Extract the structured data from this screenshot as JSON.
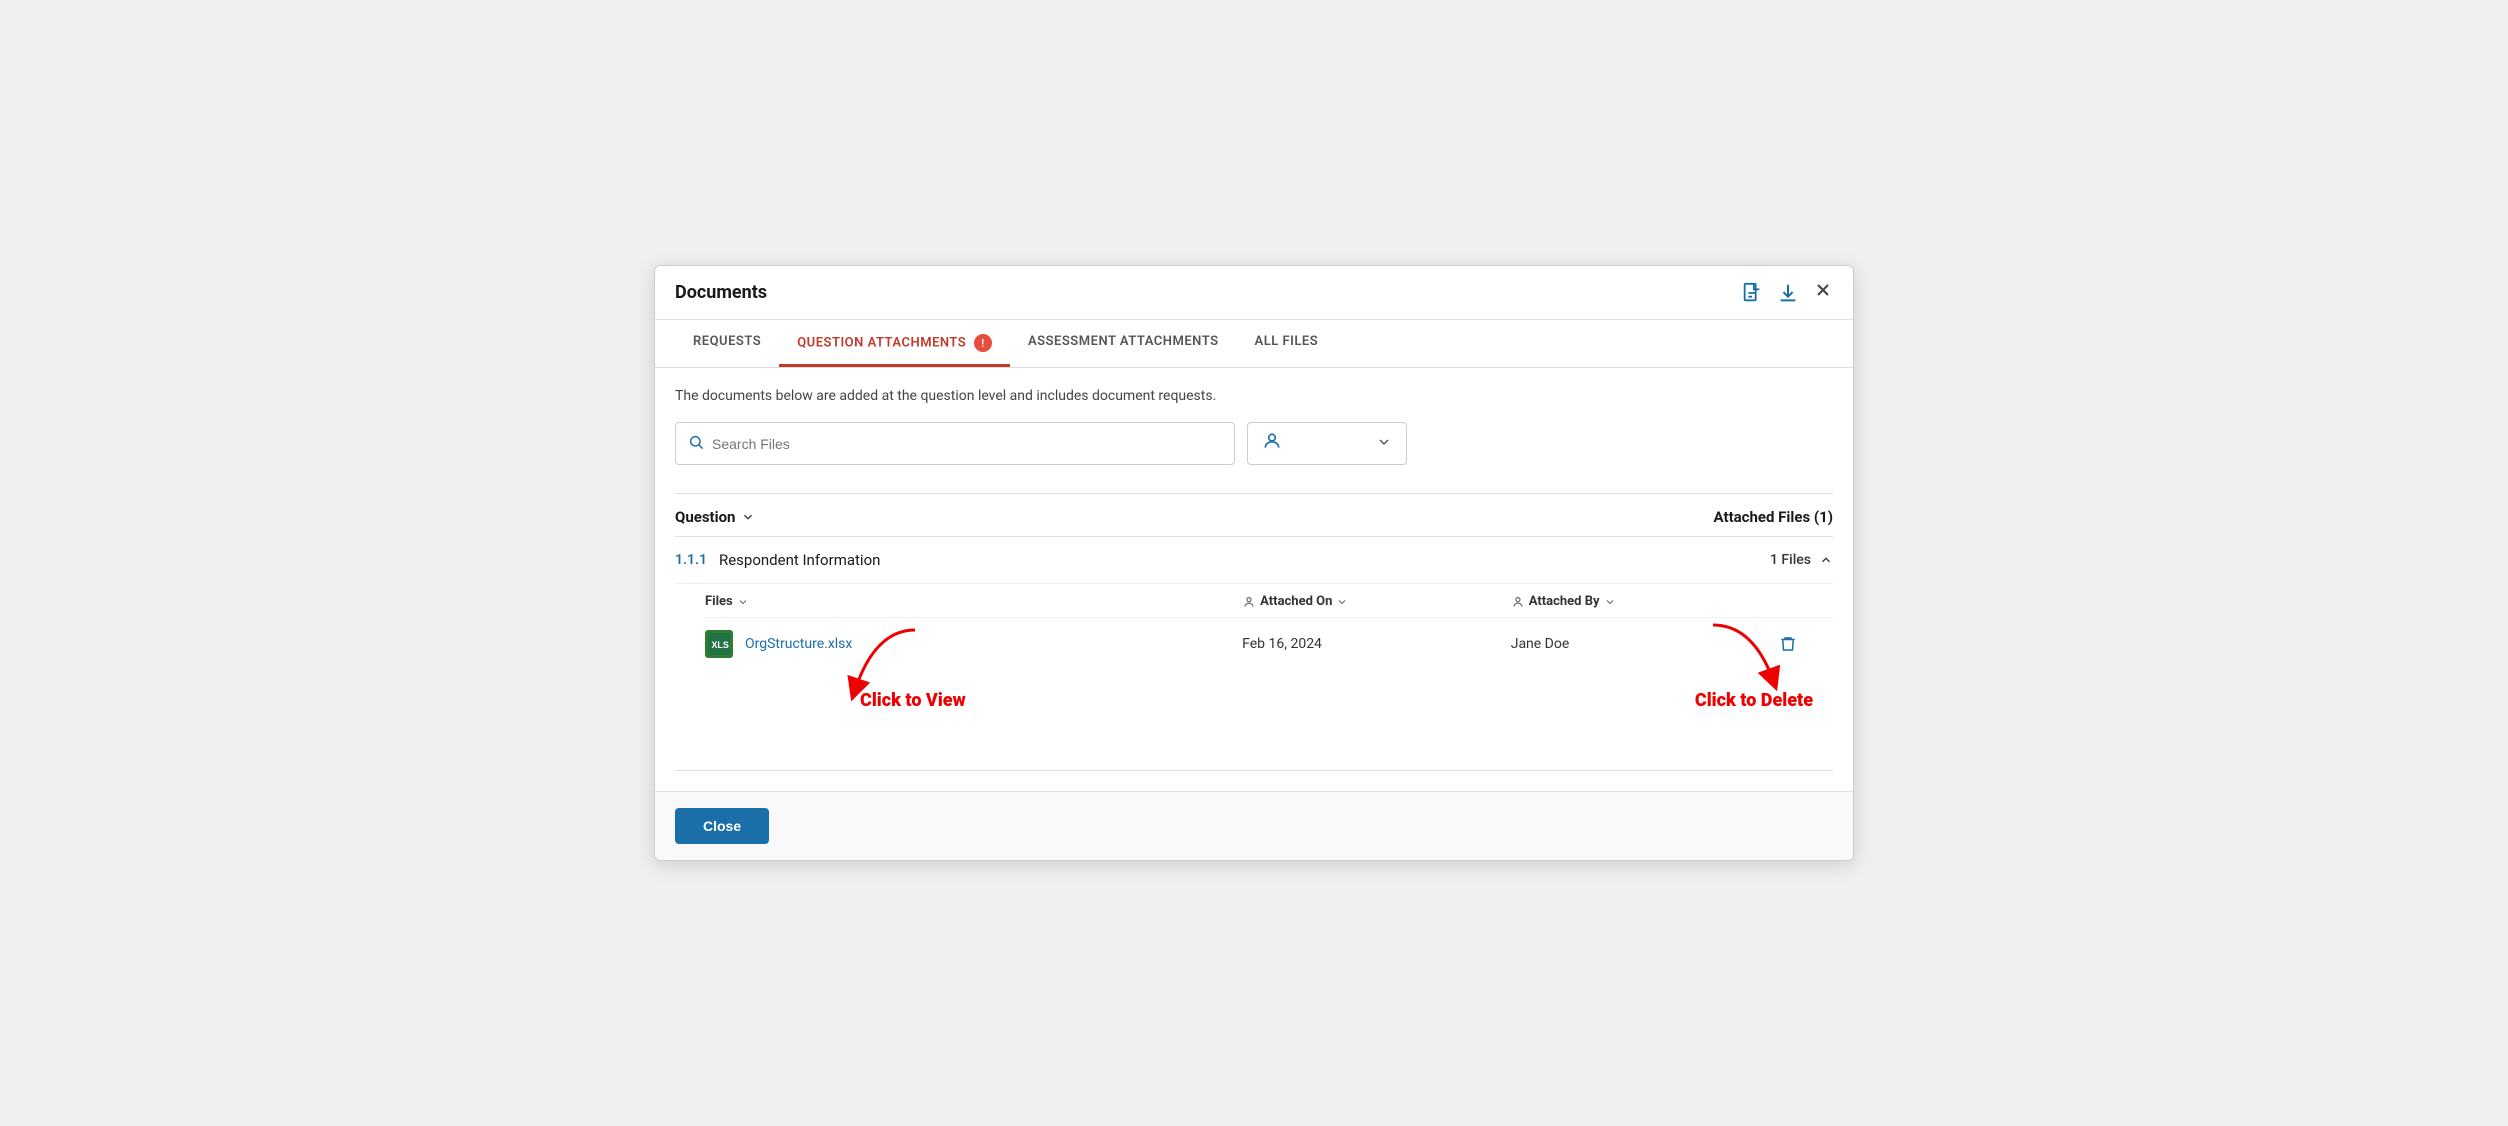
{
  "modal": {
    "title": "Documents",
    "tabs": [
      {
        "id": "requests",
        "label": "REQUESTS",
        "active": false
      },
      {
        "id": "question-attachments",
        "label": "QUESTION ATTACHMENTS",
        "active": true,
        "badge": "!"
      },
      {
        "id": "assessment-attachments",
        "label": "ASSESSMENT ATTACHMENTS",
        "active": false
      },
      {
        "id": "all-files",
        "label": "ALL FILES",
        "active": false
      }
    ],
    "description": "The documents below are added at the question level and includes document requests.",
    "search": {
      "placeholder": "Search Files"
    },
    "table": {
      "question_header": "Question",
      "attached_files_header": "Attached Files (1)",
      "question_number": "1.1.1",
      "question_text": "Respondent Information",
      "files_count": "1 Files",
      "columns": {
        "files": "Files",
        "attached_on": "Attached On",
        "attached_by": "Attached By"
      },
      "file": {
        "name": "OrgStructure.xlsx",
        "attached_on": "Feb 16, 2024",
        "attached_by": "Jane Doe"
      }
    },
    "annotations": {
      "click_to_view": "Click to View",
      "click_to_delete": "Click to Delete"
    },
    "footer": {
      "close_label": "Close"
    }
  },
  "icons": {
    "doc": "📄",
    "download": "⬇",
    "close": "✕",
    "search": "🔍",
    "user": "👤",
    "chevron_down": "∨",
    "chevron_down_sm": "⌄",
    "trash": "🗑",
    "expand": "∧",
    "person_sm": "👤"
  }
}
